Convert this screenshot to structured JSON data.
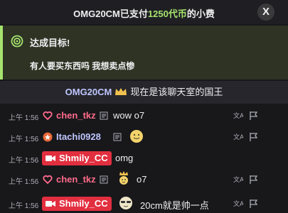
{
  "tip": {
    "user": "OMG20CM",
    "text_before": "已支付",
    "amount": "1250代币",
    "text_after": "的小费",
    "close_label": "X"
  },
  "goal": {
    "title": "达成目标!",
    "body": "有人要买东西吗 我想卖点惨"
  },
  "king": {
    "name": "OMG20CM",
    "label": "现在是该聊天室的国王"
  },
  "messages": [
    {
      "time": "上午 1:56",
      "user": "chen_tkz",
      "text": "wow o7",
      "user_color": "#ff6b8a",
      "badge": "heart"
    },
    {
      "time": "上午 1:56",
      "user": "Itachi0928",
      "text": "",
      "user_color": "#bfc7ff",
      "badge": "star"
    },
    {
      "time": "上午 1:56",
      "user": "Shmily_CC",
      "text": "omg",
      "badge": "camera"
    },
    {
      "time": "上午 1:56",
      "user": "chen_tkz",
      "text": "o7",
      "user_color": "#ff6b8a",
      "badge": "heart"
    },
    {
      "time": "上午 1:56",
      "user": "Shmily_CC",
      "text": "20cm就是帅一点",
      "badge": "camera"
    }
  ],
  "colors": {
    "accent_green": "#a6e36e",
    "broadcaster_red": "#e22f3f"
  }
}
